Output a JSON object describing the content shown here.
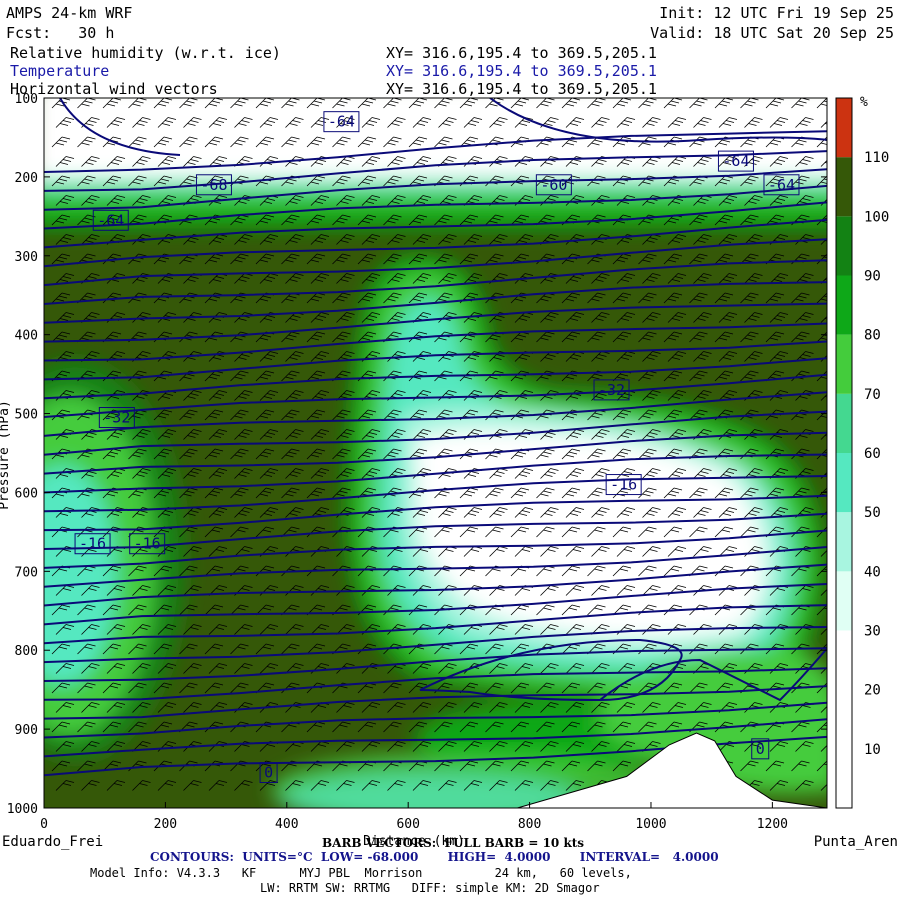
{
  "header": {
    "model": "AMPS 24-km WRF",
    "init": "Init: 12 UTC Fri 19 Sep 25",
    "fcst": "Fcst:   30 h",
    "valid": "Valid: 18 UTC Sat 20 Sep 25",
    "fields": [
      {
        "name": "Relative humidity (w.r.t. ice)",
        "xy": "XY= 316.6,195.4 to 369.5,205.1"
      },
      {
        "name": "Temperature",
        "xy": "XY= 316.6,195.4 to 369.5,205.1"
      },
      {
        "name": "Horizontal wind vectors",
        "xy": "XY= 316.6,195.4 to 369.5,205.1"
      }
    ]
  },
  "footer": {
    "barb": "BARB VECTORS:  FULL BARB = 10 kts",
    "contours": "CONTOURS:  UNITS=°C  LOW= -68.000       HIGH=  4.0000       INTERVAL=   4.0000",
    "model_info": "Model Info: V4.3.3   KF      MYJ PBL  Morrison          24 km,   60 levels,",
    "physics": "LW: RRTM SW: RRTMG   DIFF: simple KM: 2D Smagor",
    "left_station": "Eduardo_Frei",
    "right_station": "Punta_Aren"
  },
  "colors": {
    "temp_contour": "#0a0a78",
    "terrain": "#ffffff",
    "rh_scale": [
      "#ffffff",
      "#ffffff",
      "#ffffff",
      "#e0fff4",
      "#a8f5e0",
      "#55e8c0",
      "#44d890",
      "#44cc3c",
      "#0ea818",
      "#138214",
      "#355808",
      "#cc3311"
    ]
  },
  "chart_data": {
    "type": "heatmap",
    "title": "",
    "xlabel": "Distance (km)",
    "ylabel": "Pressure (hPa)",
    "x_ticks": [
      0,
      200,
      400,
      600,
      800,
      1000,
      1200
    ],
    "y_ticks": [
      100,
      200,
      300,
      400,
      500,
      600,
      700,
      800,
      900,
      1000
    ],
    "xlim": [
      0,
      1290
    ],
    "ylim": [
      1000,
      100
    ],
    "colorbar": {
      "unit": "%",
      "ticks": [
        10,
        20,
        30,
        40,
        50,
        60,
        70,
        80,
        90,
        100,
        110
      ],
      "bounds": [
        0,
        10,
        20,
        30,
        40,
        50,
        60,
        70,
        80,
        90,
        100,
        110,
        120
      ]
    },
    "temperature_labels": [
      {
        "text": "-64",
        "x": 490,
        "p": 130
      },
      {
        "text": "-68",
        "x": 280,
        "p": 210
      },
      {
        "text": "-64",
        "x": 110,
        "p": 255
      },
      {
        "text": "-60",
        "x": 840,
        "p": 210
      },
      {
        "text": "-64",
        "x": 1140,
        "p": 180
      },
      {
        "text": "-64",
        "x": 1215,
        "p": 210
      },
      {
        "text": "-32",
        "x": 935,
        "p": 470
      },
      {
        "text": "-32",
        "x": 120,
        "p": 505
      },
      {
        "text": "-16",
        "x": 955,
        "p": 590
      },
      {
        "text": "-16",
        "x": 80,
        "p": 665
      },
      {
        "text": "-16",
        "x": 170,
        "p": 665
      },
      {
        "text": "0",
        "x": 1180,
        "p": 925
      },
      {
        "text": "0",
        "x": 370,
        "p": 955
      }
    ],
    "terrain_profile": [
      [
        0,
        1000
      ],
      [
        250,
        1000
      ],
      [
        500,
        1000
      ],
      [
        780,
        1000
      ],
      [
        960,
        960
      ],
      [
        1030,
        920
      ],
      [
        1075,
        905
      ],
      [
        1105,
        915
      ],
      [
        1140,
        960
      ],
      [
        1200,
        990
      ],
      [
        1290,
        1000
      ]
    ]
  }
}
